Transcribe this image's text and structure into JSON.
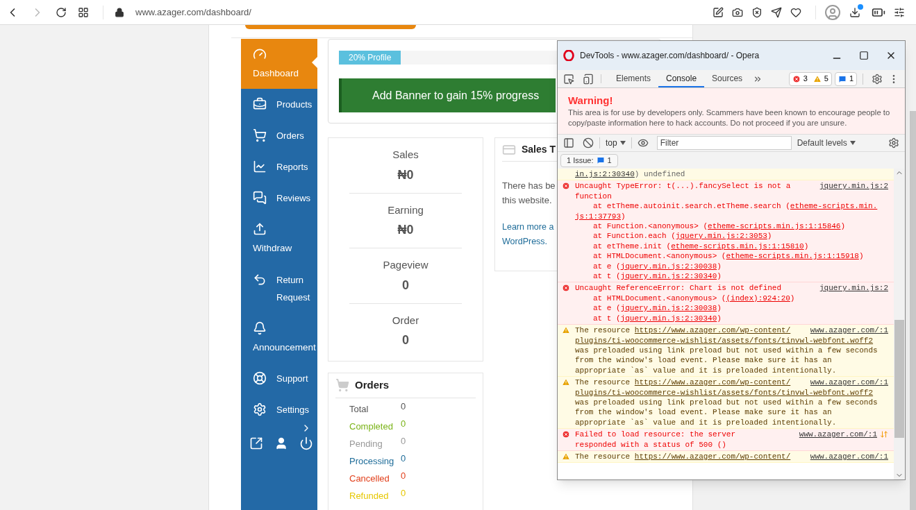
{
  "browser": {
    "url": "www.azager.com/dashboard/"
  },
  "sidebar": {
    "items": [
      {
        "label": "Dashboard",
        "kind": "stacked",
        "selected": true
      },
      {
        "label": "Products",
        "kind": "inline",
        "selected": false
      },
      {
        "label": "Orders",
        "kind": "inline",
        "selected": false
      },
      {
        "label": "Reports",
        "kind": "inline",
        "selected": false
      },
      {
        "label": "Reviews",
        "kind": "inline",
        "selected": false
      },
      {
        "label": "Withdraw",
        "kind": "stacked",
        "selected": false
      },
      {
        "label": "Return Request",
        "kind": "inline",
        "selected": false
      },
      {
        "label": "Announcement",
        "kind": "stacked",
        "selected": false
      },
      {
        "label": "Support",
        "kind": "inline",
        "selected": false
      },
      {
        "label": "Settings",
        "kind": "inline",
        "selected": false
      }
    ]
  },
  "profile": {
    "label": "20% Profile",
    "level": 0.2,
    "banner": "Add Banner to gain 15% progress"
  },
  "stats": [
    {
      "label": "Sales",
      "value": "₦0"
    },
    {
      "label": "Earning",
      "value": "₦0"
    },
    {
      "label": "Pageview",
      "value": "0"
    },
    {
      "label": "Order",
      "value": "0"
    }
  ],
  "sales_card": {
    "title": "Sales T",
    "body_lines": [
      "There has be",
      "this website."
    ],
    "link_lines": [
      "Learn more a",
      "WordPress."
    ]
  },
  "orders": {
    "title": "Orders",
    "rows": [
      {
        "label": "Total",
        "value": "0",
        "color": "#555555"
      },
      {
        "label": "Completed",
        "value": "0",
        "color": "#7ab317"
      },
      {
        "label": "Pending",
        "value": "0",
        "color": "#999999"
      },
      {
        "label": "Processing",
        "value": "0",
        "color": "#1e6c99"
      },
      {
        "label": "Cancelled",
        "value": "0",
        "color": "#e2401c"
      },
      {
        "label": "Refunded",
        "value": "0",
        "color": "#e6c700"
      }
    ]
  },
  "devtools": {
    "title": "DevTools - www.azager.com/dashboard/ - Opera",
    "tabs": [
      {
        "label": "Elements",
        "selected": false
      },
      {
        "label": "Console",
        "selected": true
      },
      {
        "label": "Sources",
        "selected": false
      }
    ],
    "counts": {
      "errors": "3",
      "warnings": "5",
      "issues": "1"
    },
    "warning": {
      "title": "Warning!",
      "text": "This area is for use by developers only. Scammers have been known to encourage people to copy/paste information here to hack accounts. Do not proceed if you are unsure."
    },
    "toolbar": {
      "context": "top",
      "filter_placeholder": "Filter",
      "levels": "Default levels"
    },
    "issues": {
      "label": "1 Issue:",
      "count": "1"
    },
    "messages": [
      {
        "kind": "log",
        "lines": [
          {
            "link": "in.js:2:30340",
            "post": ") undefined"
          }
        ]
      },
      {
        "kind": "error",
        "source": "jquery.min.js:2",
        "lines": [
          {
            "pre": "Uncaught TypeError: t(...).fancySelect is not a"
          },
          {
            "pre": "function"
          },
          {
            "pre": "at etTheme.autoinit.search.etTheme.search (",
            "link": "etheme-scripts.min.",
            "indent": true
          },
          {
            "link": "js:1:37793",
            "post": ")"
          },
          {
            "pre": "at Function.<anonymous> (",
            "link": "etheme-scripts.min.js:1:15846",
            "post": ")",
            "indent": true
          },
          {
            "pre": "at Function.each (",
            "link": "jquery.min.js:2:3053",
            "post": ")",
            "indent": true
          },
          {
            "pre": "at etTheme.init (",
            "link": "etheme-scripts.min.js:1:15810",
            "post": ")",
            "indent": true
          },
          {
            "pre": "at HTMLDocument.<anonymous> (",
            "link": "etheme-scripts.min.js:1:15918",
            "post": ")",
            "indent": true
          },
          {
            "pre": "at e (",
            "link": "jquery.min.js:2:30038",
            "post": ")",
            "indent": true
          },
          {
            "pre": "at t (",
            "link": "jquery.min.js:2:30340",
            "post": ")",
            "indent": true
          }
        ]
      },
      {
        "kind": "error",
        "source": "jquery.min.js:2",
        "lines": [
          {
            "pre": "Uncaught ReferenceError: Chart is not defined"
          },
          {
            "pre": "at HTMLDocument.<anonymous> (",
            "link": "(index):924:20",
            "post": ")",
            "indent": true
          },
          {
            "pre": "at e (",
            "link": "jquery.min.js:2:30038",
            "post": ")",
            "indent": true
          },
          {
            "pre": "at t (",
            "link": "jquery.min.js:2:30340",
            "post": ")",
            "indent": true
          }
        ]
      },
      {
        "kind": "warning",
        "source": "www.azager.com/:1",
        "lines": [
          {
            "pre": "The resource ",
            "link": "https://www.azager.com/wp-content/"
          },
          {
            "link": "plugins/ti-woocommerce-wishlist/assets/fonts/tinvwl-webfont.woff2"
          },
          {
            "pre": "was preloaded using link preload but not used within a few seconds"
          },
          {
            "pre": "from the window's load event. Please make sure it has an"
          },
          {
            "pre": "appropriate `as` value and it is preloaded intentionally."
          }
        ]
      },
      {
        "kind": "warning",
        "source": "www.azager.com/:1",
        "lines": [
          {
            "pre": "The resource ",
            "link": "https://www.azager.com/wp-content/"
          },
          {
            "link": "plugins/ti-woocommerce-wishlist/assets/fonts/tinvwl-webfont.woff2"
          },
          {
            "pre": "was preloaded using link preload but not used within a few seconds"
          },
          {
            "pre": "from the window's load event. Please make sure it has an"
          },
          {
            "pre": "appropriate `as` value and it is preloaded intentionally."
          }
        ]
      },
      {
        "kind": "error",
        "source": "www.azager.com/:1",
        "network": true,
        "lines": [
          {
            "pre": "Failed to load resource: the server"
          },
          {
            "pre": "responded with a status of 500 ()"
          }
        ]
      },
      {
        "kind": "warning",
        "source": "www.azager.com/:1",
        "lines": [
          {
            "pre": "The resource ",
            "link": "https://www.azager.com/wp-content/"
          }
        ]
      }
    ]
  }
}
